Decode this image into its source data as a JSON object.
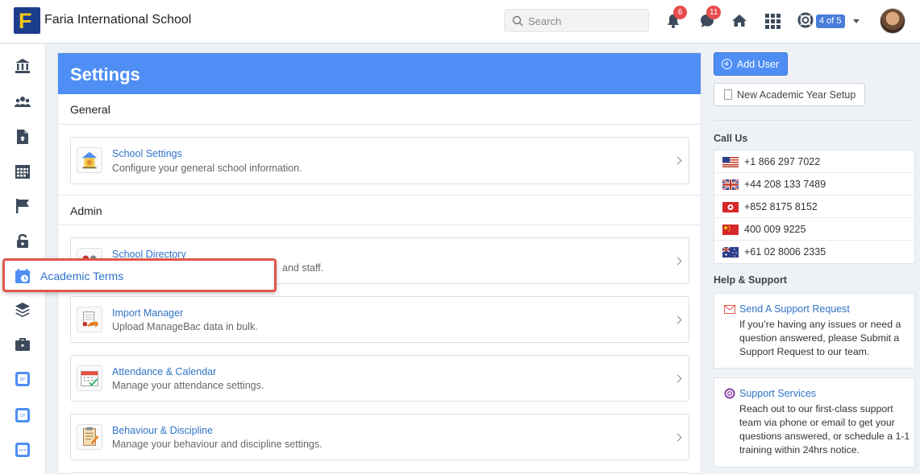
{
  "header": {
    "logo_letter": "F",
    "school_name": "Faria International School",
    "search_placeholder": "Search",
    "notifications_count": "6",
    "messages_count": "11",
    "pager_label": "4 of 5"
  },
  "sidebar": {
    "icons": [
      "institution-icon",
      "users-icon",
      "file-icon",
      "calendar-grid-icon",
      "flag-icon",
      "unlock-icon",
      "academic-terms-icon",
      "layers-icon",
      "briefcase-icon",
      "dp-icon",
      "cp-icon",
      "myp-icon"
    ]
  },
  "settings": {
    "title": "Settings",
    "sections": [
      {
        "title": "General",
        "items": [
          {
            "title": "School Settings",
            "desc": "Configure your general school information."
          }
        ]
      },
      {
        "title": "Admin",
        "items": [
          {
            "title": "School Directory",
            "desc": "and staff."
          },
          {
            "title": "Import Manager",
            "desc": "Upload ManageBac data in bulk."
          },
          {
            "title": "Attendance & Calendar",
            "desc": "Manage your attendance settings."
          },
          {
            "title": "Behaviour & Discipline",
            "desc": "Manage your behaviour and discipline settings."
          }
        ]
      }
    ]
  },
  "highlight": {
    "label": "Academic Terms"
  },
  "right": {
    "add_user": "Add User",
    "new_academic_year": "New Academic Year Setup",
    "call_us": "Call Us",
    "phones": [
      {
        "flag": "us",
        "number": "+1 866 297 7022"
      },
      {
        "flag": "uk",
        "number": "+44 208 133 7489"
      },
      {
        "flag": "hk",
        "number": "+852 8175 8152"
      },
      {
        "flag": "cn",
        "number": "400 009 9225"
      },
      {
        "flag": "au",
        "number": "+61 02 8006 2335"
      }
    ],
    "help_support": "Help & Support",
    "support_request": {
      "title": "Send A Support Request",
      "text": "If you’re having any issues or need a question answered, please Submit a Support Request to our team."
    },
    "support_services": {
      "title": "Support Services",
      "text": "Reach out to our first-class support team via phone or email to get your questions answered, or schedule a 1-1 training within 24hrs notice."
    }
  },
  "colors": {
    "accent": "#4f8ff5",
    "link": "#2f74c9",
    "badge": "#e74c4c",
    "highlight_border": "#e2564a"
  }
}
